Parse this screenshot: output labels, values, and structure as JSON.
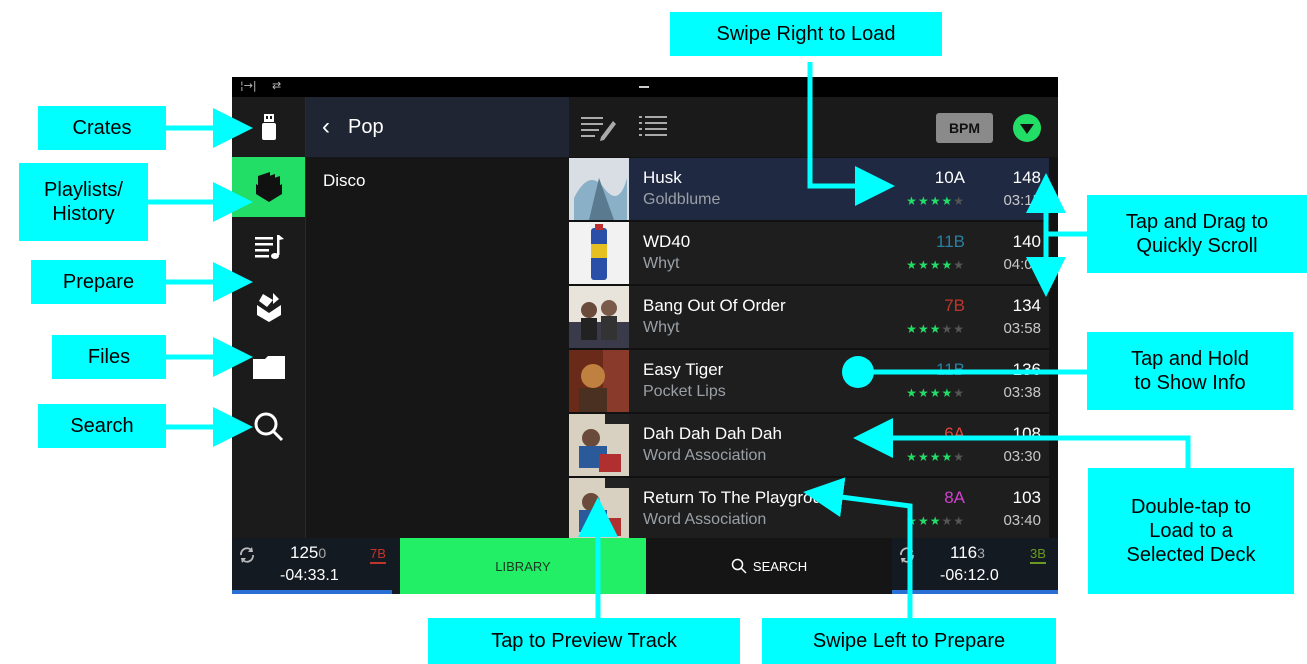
{
  "callouts": {
    "swipe_right": "Swipe Right to Load",
    "crates": "Crates",
    "playlists": "Playlists/\nHistory",
    "prepare": "Prepare",
    "files": "Files",
    "search": "Search",
    "tap_drag": "Tap and Drag to\nQuickly Scroll",
    "tap_hold": "Tap and Hold\nto Show Info",
    "double_tap": "Double-tap to\nLoad to a\nSelected Deck",
    "tap_preview": "Tap to Preview Track",
    "swipe_left": "Swipe Left to Prepare"
  },
  "crate_panel": {
    "title": "Pop",
    "items": [
      "Disco"
    ]
  },
  "track_header": {
    "sort_label": "BPM"
  },
  "tracks": [
    {
      "title": "Husk",
      "artist": "Goldblume",
      "key": "10A",
      "key_color": "#ffffff",
      "bpm": "148",
      "time": "03:15",
      "rating": 4,
      "selected": true
    },
    {
      "title": "WD40",
      "artist": "Whyt",
      "key": "11B",
      "key_color": "#2a7fa0",
      "bpm": "140",
      "time": "04:02",
      "rating": 4,
      "selected": false
    },
    {
      "title": "Bang Out Of Order",
      "artist": "Whyt",
      "key": "7B",
      "key_color": "#c0352b",
      "bpm": "134",
      "time": "03:58",
      "rating": 3,
      "selected": false
    },
    {
      "title": "Easy Tiger",
      "artist": "Pocket Lips",
      "key": "11B",
      "key_color": "#2a7fa0",
      "bpm": "136",
      "time": "03:38",
      "rating": 4,
      "selected": false
    },
    {
      "title": "Dah Dah Dah Dah",
      "artist": "Word Association",
      "key": "6A",
      "key_color": "#e0433a",
      "bpm": "108",
      "time": "03:30",
      "rating": 4,
      "selected": false
    },
    {
      "title": "Return To The Playground",
      "artist": "Word Association",
      "key": "8A",
      "key_color": "#d040d0",
      "bpm": "103",
      "time": "03:40",
      "rating": 3,
      "selected": false
    }
  ],
  "deck_left": {
    "bpm": "125",
    "bpm_decimal": "0",
    "key": "7B",
    "key_color": "#c0352b",
    "time": "-04:33.1"
  },
  "deck_right": {
    "bpm": "116",
    "bpm_decimal": "3",
    "key": "3B",
    "key_color": "#6a9a20",
    "time": "-06:12.0"
  },
  "bottom": {
    "library_label": "LIBRARY",
    "search_label": "SEARCH"
  }
}
